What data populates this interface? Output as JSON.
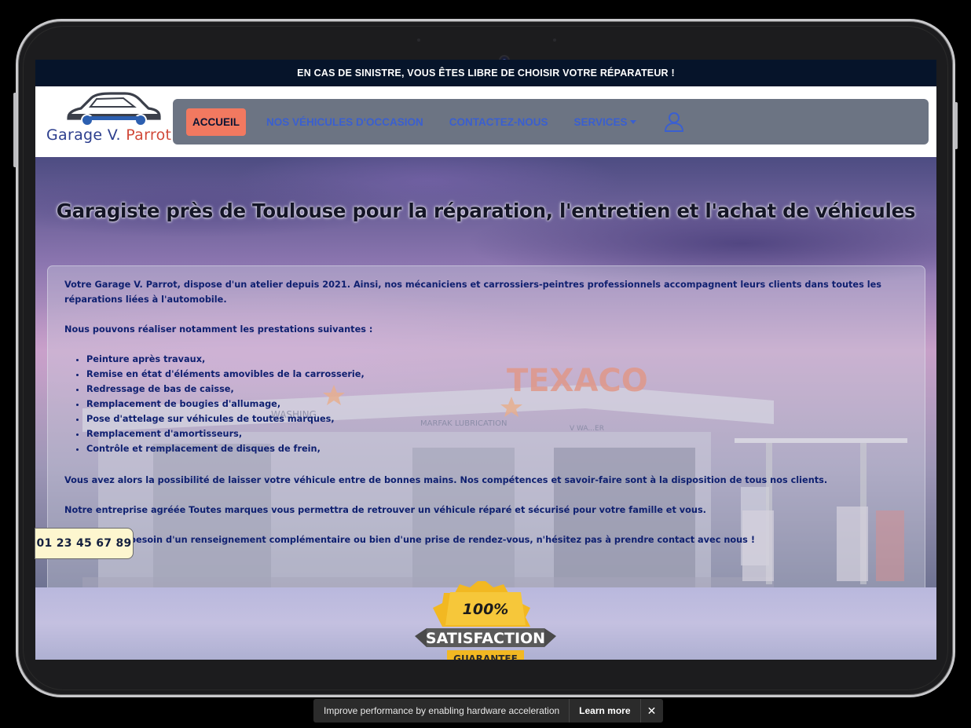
{
  "topbar": {
    "text": "EN CAS DE SINISTRE, VOUS ÊTES LIBRE DE CHOISIR VOTRE RÉPARATEUR !"
  },
  "logo": {
    "name_part1": "Garage V.",
    "name_part2": "Parrot"
  },
  "nav": {
    "home": "ACCUEIL",
    "used_cars": "NOS VÉHICULES D'OCCASION",
    "contact": "CONTACTEZ-NOUS",
    "services": "SERVICES"
  },
  "hero": {
    "title": "Garagiste près de Toulouse pour la réparation, l'entretien et l'achat de véhicules",
    "intro": "Votre Garage V. Parrot, dispose d'un atelier depuis 2021. Ainsi, nos mécaniciens et carrossiers-peintres professionnels accompagnent leurs clients dans toutes les réparations liées à l'automobile.",
    "services_intro": "Nous pouvons réaliser notamment les prestations suivantes :",
    "services": [
      "Peinture après travaux,",
      "Remise en état d'éléments amovibles de la carrosserie,",
      "Redressage de bas de caisse,",
      "Remplacement de bougies d'allumage,",
      "Pose d'attelage sur véhicules de toutes marques,",
      "Remplacement d'amortisseurs,",
      "Contrôle et remplacement de disques de frein,"
    ],
    "para1": "Vous avez alors la possibilité de laisser votre véhicule entre de bonnes mains. Nos compétences et savoir-faire sont à la disposition de tous nos clients.",
    "para2": "Notre entreprise agréée Toutes marques vous permettra de retrouver un véhicule réparé et sécurisé pour votre famille et vous.",
    "para3": "Si vous avez besoin d'un renseignement complémentaire ou bien d'une prise de rendez-vous, n'hésitez pas à prendre contact avec nous !"
  },
  "background_sign": {
    "brand": "TEXACO",
    "washing": "WASHING",
    "lubrication": "MARFAK LUBRICATION",
    "walker": "V WA...ER"
  },
  "phone": {
    "number": "01 23 45 67 89"
  },
  "badge": {
    "percent": "100%",
    "label": "SATISFACTION",
    "sub": "GUARANTEE"
  },
  "toast": {
    "message": "Improve performance by enabling hardware acceleration",
    "link": "Learn more",
    "close": "✕"
  },
  "colors": {
    "topbar": "#06142a",
    "navbar": "#6c7483",
    "active_tab": "#f27960",
    "nav_link": "#3a5fd0",
    "body_text": "#0f2070",
    "phone_bg": "#fdf6cf"
  }
}
